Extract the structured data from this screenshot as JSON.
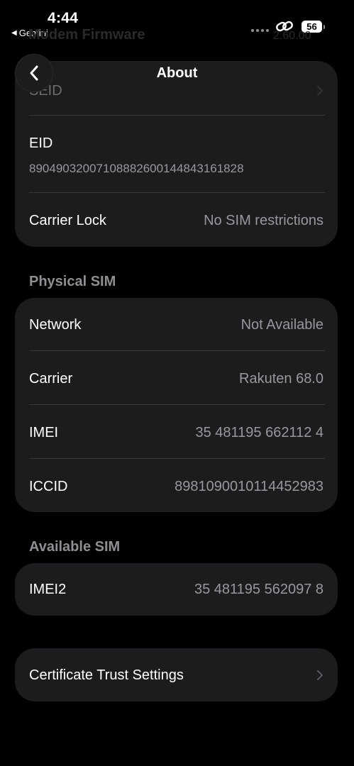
{
  "status_bar": {
    "time": "4:44",
    "back_app": "Gemini",
    "battery": "56"
  },
  "ghost": {
    "left_text": "Modem Firmware",
    "right_text": "2.60.00"
  },
  "nav": {
    "title": "About"
  },
  "card1": {
    "seid_label": "SEID",
    "eid_label": "EID",
    "eid_value": "89049032007108882600144843161828",
    "carrier_lock_label": "Carrier Lock",
    "carrier_lock_value": "No SIM restrictions"
  },
  "physical_sim": {
    "header": "Physical SIM",
    "rows": [
      {
        "label": "Network",
        "value": "Not Available"
      },
      {
        "label": "Carrier",
        "value": "Rakuten 68.0"
      },
      {
        "label": "IMEI",
        "value": "35 481195 662112 4"
      },
      {
        "label": "ICCID",
        "value": "8981090010114452983"
      }
    ]
  },
  "available_sim": {
    "header": "Available SIM",
    "rows": [
      {
        "label": "IMEI2",
        "value": "35 481195 562097 8"
      }
    ]
  },
  "certificate": {
    "label": "Certificate Trust Settings"
  },
  "colors": {
    "background": "#000000",
    "card": "#1c1c1e",
    "separator": "#38383a",
    "secondary_text": "#98989d"
  }
}
